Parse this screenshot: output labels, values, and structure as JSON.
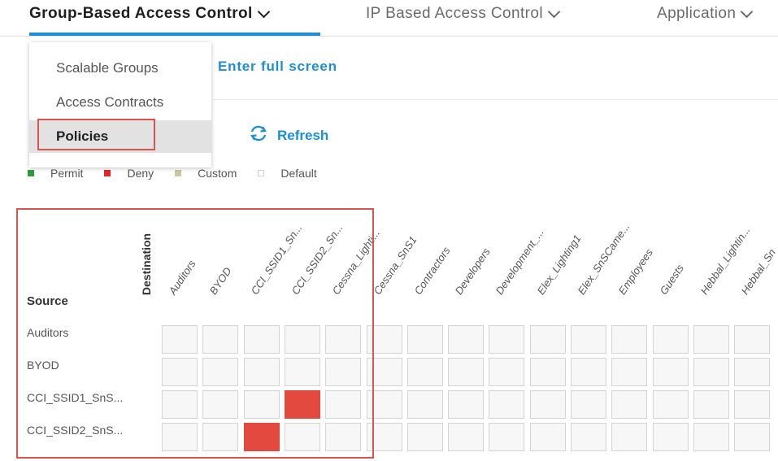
{
  "nav": {
    "tabs": [
      {
        "label": "Group-Based Access Control"
      },
      {
        "label": "IP Based Access Control"
      },
      {
        "label": "Application"
      }
    ]
  },
  "dropdown": {
    "items": [
      {
        "label": "Scalable Groups"
      },
      {
        "label": "Access Contracts"
      },
      {
        "label": "Policies"
      }
    ],
    "selected": "Policies"
  },
  "toolbar": {
    "fullscreen_label": "Enter full screen",
    "refresh_label": "Refresh"
  },
  "legend": [
    {
      "label": "Permit",
      "color": "#2e9a3a"
    },
    {
      "label": "Deny",
      "color": "#e4272b"
    },
    {
      "label": "Custom",
      "color": "#cbc79b"
    },
    {
      "label": "Default",
      "color": "#ffffff"
    }
  ],
  "matrix": {
    "destination_label": "Destination",
    "source_label": "Source",
    "columns": [
      "Auditors",
      "BYOD",
      "CCI_SSID1_Sn...",
      "CCI_SSID2_Sn...",
      "Cessna_Lighti...",
      "Cessna_SnS1",
      "Contractors",
      "Developers",
      "Development_...",
      "Elex_Lighting1",
      "Elex_SnSCame...",
      "Employees",
      "Guests",
      "Hebbal_Lightin...",
      "Hebbal_Sn"
    ],
    "rows": [
      {
        "label": "Auditors",
        "cells": [
          "default",
          "default",
          "default",
          "default",
          "default",
          "default",
          "default",
          "default",
          "default",
          "default",
          "default",
          "default",
          "default",
          "default",
          "default"
        ]
      },
      {
        "label": "BYOD",
        "cells": [
          "default",
          "default",
          "default",
          "default",
          "default",
          "default",
          "default",
          "default",
          "default",
          "default",
          "default",
          "default",
          "default",
          "default",
          "default"
        ]
      },
      {
        "label": "CCI_SSID1_SnS...",
        "cells": [
          "default",
          "default",
          "default",
          "deny",
          "default",
          "default",
          "default",
          "default",
          "default",
          "default",
          "default",
          "default",
          "default",
          "default",
          "default"
        ]
      },
      {
        "label": "CCI_SSID2_SnS...",
        "cells": [
          "default",
          "default",
          "deny",
          "default",
          "default",
          "default",
          "default",
          "default",
          "default",
          "default",
          "default",
          "default",
          "default",
          "default",
          "default"
        ]
      }
    ]
  }
}
